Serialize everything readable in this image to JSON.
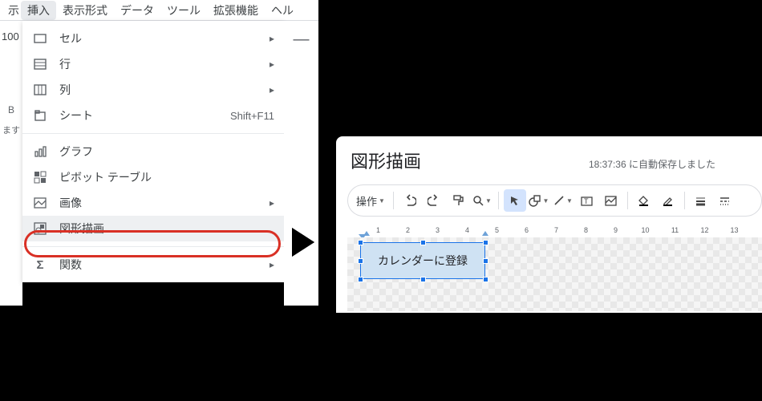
{
  "menubar": {
    "leading": "示",
    "items": [
      "挿入",
      "表示形式",
      "データ",
      "ツール",
      "拡張機能",
      "ヘル"
    ],
    "active_index": 0
  },
  "leftStrip": {
    "zoom": "100",
    "colHeadB": "B",
    "truncText": "ます"
  },
  "dropdown": {
    "groups": [
      [
        {
          "icon": "cell",
          "label": "セル",
          "sub": true
        },
        {
          "icon": "rows",
          "label": "行",
          "sub": true
        },
        {
          "icon": "cols",
          "label": "列",
          "sub": true
        },
        {
          "icon": "sheet",
          "label": "シート",
          "shortcut": "Shift+F11"
        }
      ],
      [
        {
          "icon": "chart",
          "label": "グラフ"
        },
        {
          "icon": "pivot",
          "label": "ピボット テーブル"
        },
        {
          "icon": "image",
          "label": "画像",
          "sub": true
        },
        {
          "icon": "drawing",
          "label": "図形描画",
          "highlight": true
        }
      ],
      [
        {
          "icon": "sigma",
          "label": "関数",
          "sub": true
        }
      ]
    ]
  },
  "miniCol": {
    "dash": "—"
  },
  "drawing": {
    "title": "図形描画",
    "status_time": "18:37:36",
    "status_suffix": " に自動保存しました",
    "toolbar": {
      "ops": "操作",
      "selected": "pointer"
    },
    "ruler_numbers": [
      "1",
      "2",
      "3",
      "4",
      "5",
      "6",
      "7",
      "8",
      "9",
      "10",
      "11",
      "12",
      "13"
    ],
    "shape_text": "カレンダーに登録"
  }
}
